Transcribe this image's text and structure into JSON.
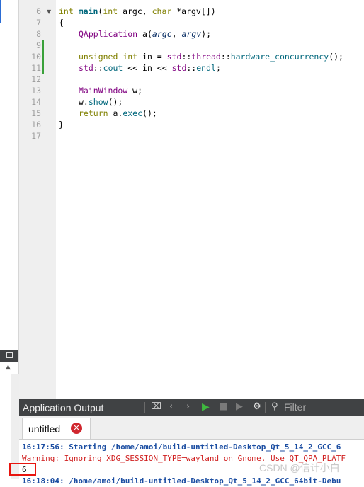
{
  "editor": {
    "line_numbers": [
      "6",
      "7",
      "8",
      "9",
      "10",
      "11",
      "12",
      "13",
      "14",
      "15",
      "16",
      "17"
    ],
    "code": {
      "l6": {
        "kw1": "int",
        "fn": "main",
        "p1": "(",
        "kw2": "int",
        "p2": " argc, ",
        "kw3": "char",
        "p3": " *argv[])"
      },
      "l7": "{",
      "l8": {
        "cls": "QApplication",
        "p1": " a(",
        "a1": "argc",
        "p2": ", ",
        "a2": "argv",
        "p3": ");"
      },
      "l10": {
        "kw1": "unsigned",
        "sp1": " ",
        "kw2": "int",
        "p1": " in = ",
        "ns1": "std",
        "p2": "::",
        "ns2": "thread",
        "p3": "::",
        "fn": "hardware_concurrency",
        "p4": "();"
      },
      "l11": {
        "ns1": "std",
        "p1": "::",
        "v1": "cout",
        "p2": " << in << ",
        "ns2": "std",
        "p3": "::",
        "v2": "endl",
        "p4": ";"
      },
      "l13": {
        "cls": "MainWindow",
        "p1": " w;"
      },
      "l14": {
        "p1": "w.",
        "fn": "show",
        "p2": "();"
      },
      "l15": {
        "kw": "return",
        "p1": " a.",
        "fn": "exec",
        "p2": "();"
      },
      "l16": "}"
    }
  },
  "output": {
    "title": "Application Output",
    "filter_placeholder": "Filter",
    "tab_label": "untitled",
    "lines": {
      "start": "16:17:56: Starting /home/amoi/build-untitled-Desktop_Qt_5_14_2_GCC_6",
      "warning": "Warning: Ignoring XDG_SESSION_TYPE=wayland on Gnome. Use QT_QPA_PLATF",
      "value": "6",
      "next": "16:18:04: /home/amoi/build-untitled-Desktop_Qt_5_14_2_GCC_64bit-Debu"
    }
  },
  "watermark": "CSDN @信计小白",
  "colors": {
    "keyword": "#808000",
    "function": "#00677c",
    "class": "#800080",
    "output_blue": "#1c4ea2",
    "output_red": "#d02020",
    "highlight": "#e8140e",
    "toolbar": "#404244"
  },
  "icons": [
    "fold-arrow-icon",
    "panel-icon",
    "scroll-up-icon",
    "clean-icon",
    "prev-icon",
    "next-icon",
    "run-icon",
    "stop-icon",
    "attach-icon",
    "gear-icon",
    "search-icon",
    "close-tab-icon"
  ]
}
